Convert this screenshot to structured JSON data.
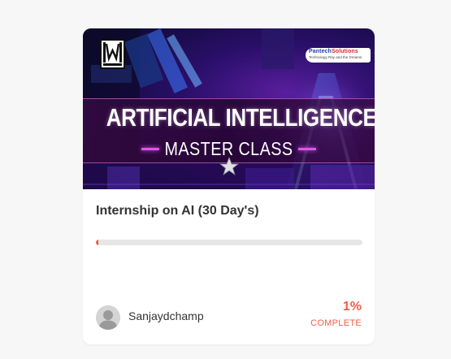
{
  "course": {
    "banner": {
      "title_line1": "ARTIFICIAL INTELLIGENCE",
      "title_line2": "MASTER CLASS",
      "partner_name_part1": "Pantech",
      "partner_name_part2": "Solutions",
      "partner_tagline": "Technology Ray and the Dreams"
    },
    "title": "Internship on AI (30 Day's)",
    "progress_fraction": 0.01,
    "percent_label": "1%",
    "status_label": "COMPLETE",
    "author": "Sanjaydchamp"
  },
  "colors": {
    "accent": "#f25d47",
    "track": "#e6e6e6",
    "card_bg": "#ffffff",
    "page_bg": "#f7f7f7"
  },
  "icons": {
    "brand_logo": "w-logo-icon",
    "star": "star-icon",
    "avatar": "user-avatar-icon"
  }
}
